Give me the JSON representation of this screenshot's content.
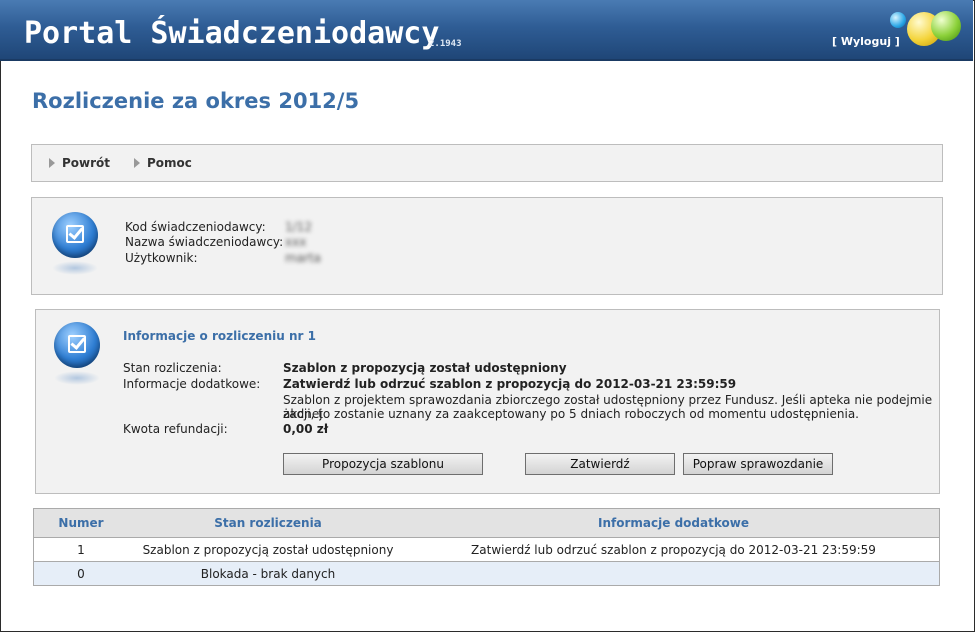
{
  "header": {
    "title": "Portal Świadczeniodawcy",
    "version": "2.1943",
    "logout": "[ Wyloguj ]"
  },
  "page_title": "Rozliczenie za okres 2012/5",
  "nav": {
    "back": "Powrót",
    "help": "Pomoc"
  },
  "provider": {
    "code_label": "Kod świadczeniodawcy:",
    "code_value": "1/12",
    "name_label": "Nazwa świadczeniodawcy:",
    "name_value": "xxx",
    "user_label": "Użytkownik:",
    "user_value": "marta"
  },
  "settlement": {
    "title": "Informacje o rozliczeniu nr 1",
    "status_label": "Stan rozliczenia:",
    "status_value": "Szablon z propozycją został udostępniony",
    "extra_label": "Informacje dodatkowe:",
    "extra_value": "Zatwierdź lub odrzuć szablon z propozycją do 2012-03-21 23:59:59",
    "extra_desc_1": "Szablon z projektem sprawozdania zbiorczego został udostępniony przez Fundusz. Jeśli apteka nie podejmie żadnej",
    "extra_desc_2": "akcji, to zostanie uznany za zaakceptowany po 5 dniach roboczych od momentu udostępnienia.",
    "amount_label": "Kwota refundacji:",
    "amount_value": "0,00 zł",
    "buttons": {
      "proposal": "Propozycja szablonu",
      "approve": "Zatwierdź",
      "fix": "Popraw sprawozdanie"
    }
  },
  "table": {
    "headers": [
      "Numer",
      "Stan rozliczenia",
      "Informacje dodatkowe"
    ],
    "rows": [
      {
        "number": "1",
        "status": "Szablon z propozycją został udostępniony",
        "info": "Zatwierdź lub odrzuć szablon z propozycją do 2012-03-21 23:59:59"
      },
      {
        "number": "0",
        "status": "Blokada - brak danych",
        "info": ""
      }
    ]
  },
  "icons": {
    "logo": "colored-balls-logo",
    "info": "checkbox-ball-icon",
    "nav": "triangle-right-icon"
  },
  "colors": {
    "header": "#2f5d95",
    "accent": "#3c6fa8",
    "panel": "#f2f2f2",
    "row_alt": "#e6eef8"
  }
}
